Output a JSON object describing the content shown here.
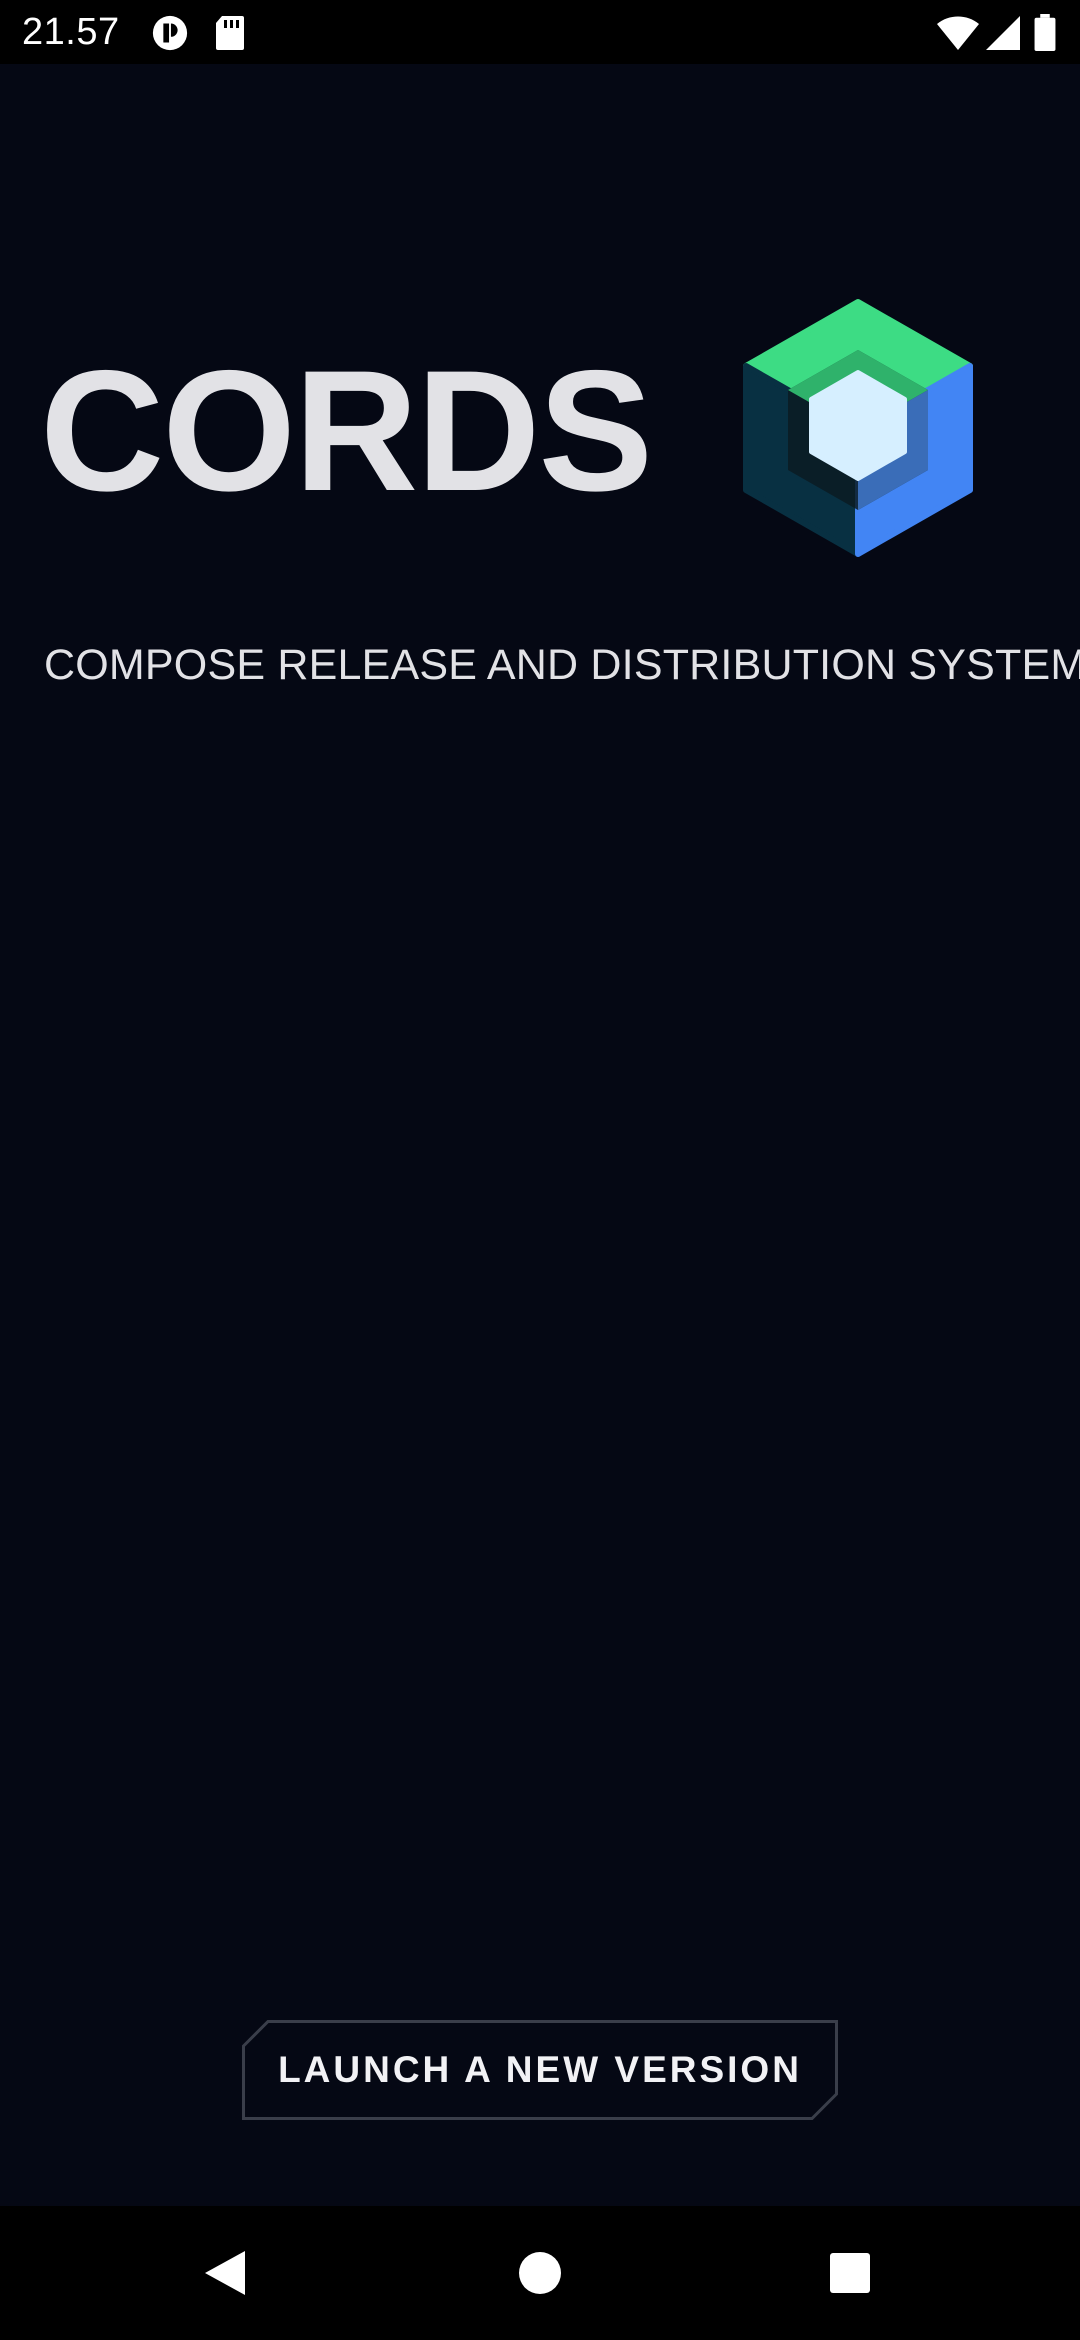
{
  "status_bar": {
    "time": "21.57",
    "icons": [
      "app-notification-icon",
      "sd-card-icon",
      "wifi-icon",
      "cellular-signal-icon",
      "battery-icon"
    ]
  },
  "main": {
    "title": "CORDS",
    "subtitle": "COMPOSE RELEASE AND DISTRIBUTION SYSTEM",
    "logo_icon": "jetpack-compose-logo-icon",
    "launch_button_label": "LAUNCH A NEW VERSION"
  },
  "nav_bar": {
    "icons": [
      "back-icon",
      "home-icon",
      "recents-icon"
    ]
  },
  "colors": {
    "background": "#050814",
    "title_text": "#e2e2e6",
    "logo_green": "#3ddc84",
    "logo_blue": "#4285f4",
    "logo_dark": "#083042",
    "logo_light": "#d6efff"
  }
}
